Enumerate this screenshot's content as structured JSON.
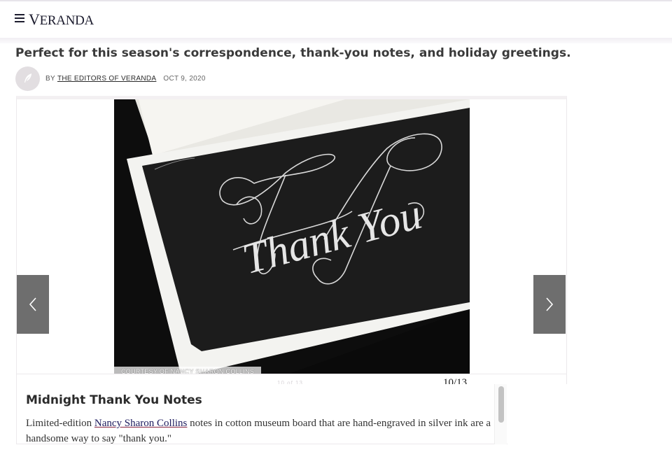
{
  "header": {
    "logo_cap": "V",
    "logo_rest": "ERANDA"
  },
  "article": {
    "dek": "Perfect for this season's correspondence, thank-you notes, and holiday greetings.",
    "by_label": "BY",
    "author": "THE EDITORS OF VERANDA",
    "date": "OCT 9, 2020"
  },
  "gallery": {
    "credit": "COURTESY OF NANCY SHARON COLLINS",
    "counter": "10/13",
    "counter_ghost": "10 of 13",
    "image_lettering": "Thank You",
    "prev_icon": "chevron-left-icon",
    "next_icon": "chevron-right-icon"
  },
  "caption": {
    "title": "Midnight Thank You Notes",
    "body_before": "Limited-edition ",
    "body_link": "Nancy Sharon Collins",
    "body_after": " notes in cotton museum board that are hand-engraved in silver ink are a handsome way to say \"thank you.\""
  },
  "colors": {
    "brand": "#1c1c2e",
    "nav_button": "#6e6e6e",
    "link_underline": "#8a2541"
  }
}
